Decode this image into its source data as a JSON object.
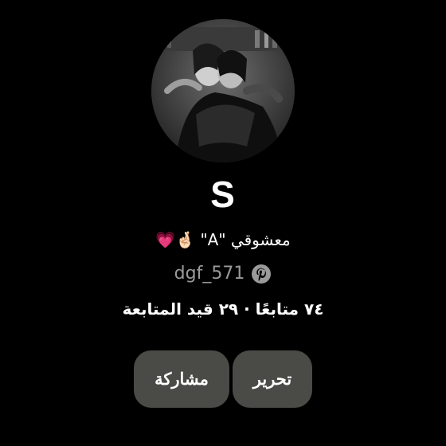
{
  "profile": {
    "name": "S",
    "bio": "معشوقي \"A\" 🤞🏻💗",
    "username": "dgf_571",
    "stats": "٧٤ متابعًا · ٢٩ قيد المتابعة",
    "brand_icon": "pinterest-icon"
  },
  "actions": {
    "edit_label": "تحرير",
    "share_label": "مشاركة"
  },
  "colors": {
    "background": "#000000",
    "button_bg": "#4a4a46",
    "muted_text": "#9a9a9a"
  }
}
